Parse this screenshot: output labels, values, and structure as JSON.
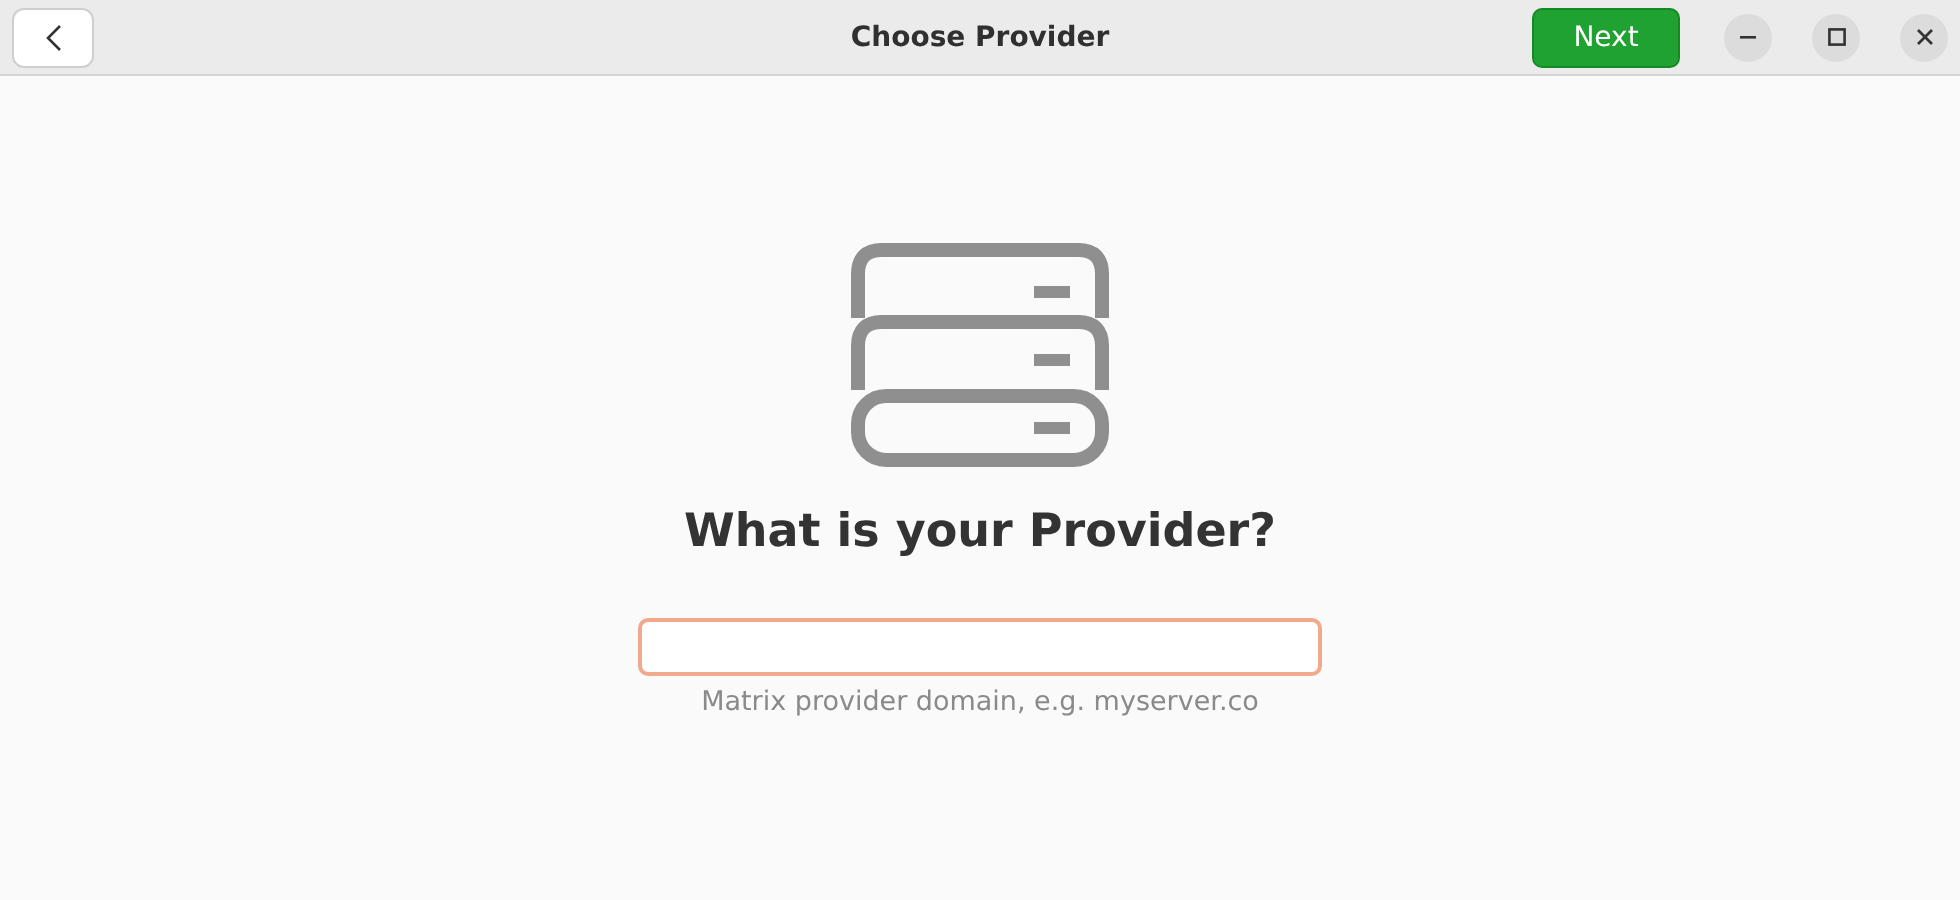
{
  "header_bar": {
    "title": "Choose Provider",
    "next_button": {
      "label": "Next",
      "disabled": false
    }
  },
  "heading": "What is your Provider?",
  "provider_field": {
    "focused": true
  },
  "hint": "Matrix provider domain, e.g. myserver.co"
}
